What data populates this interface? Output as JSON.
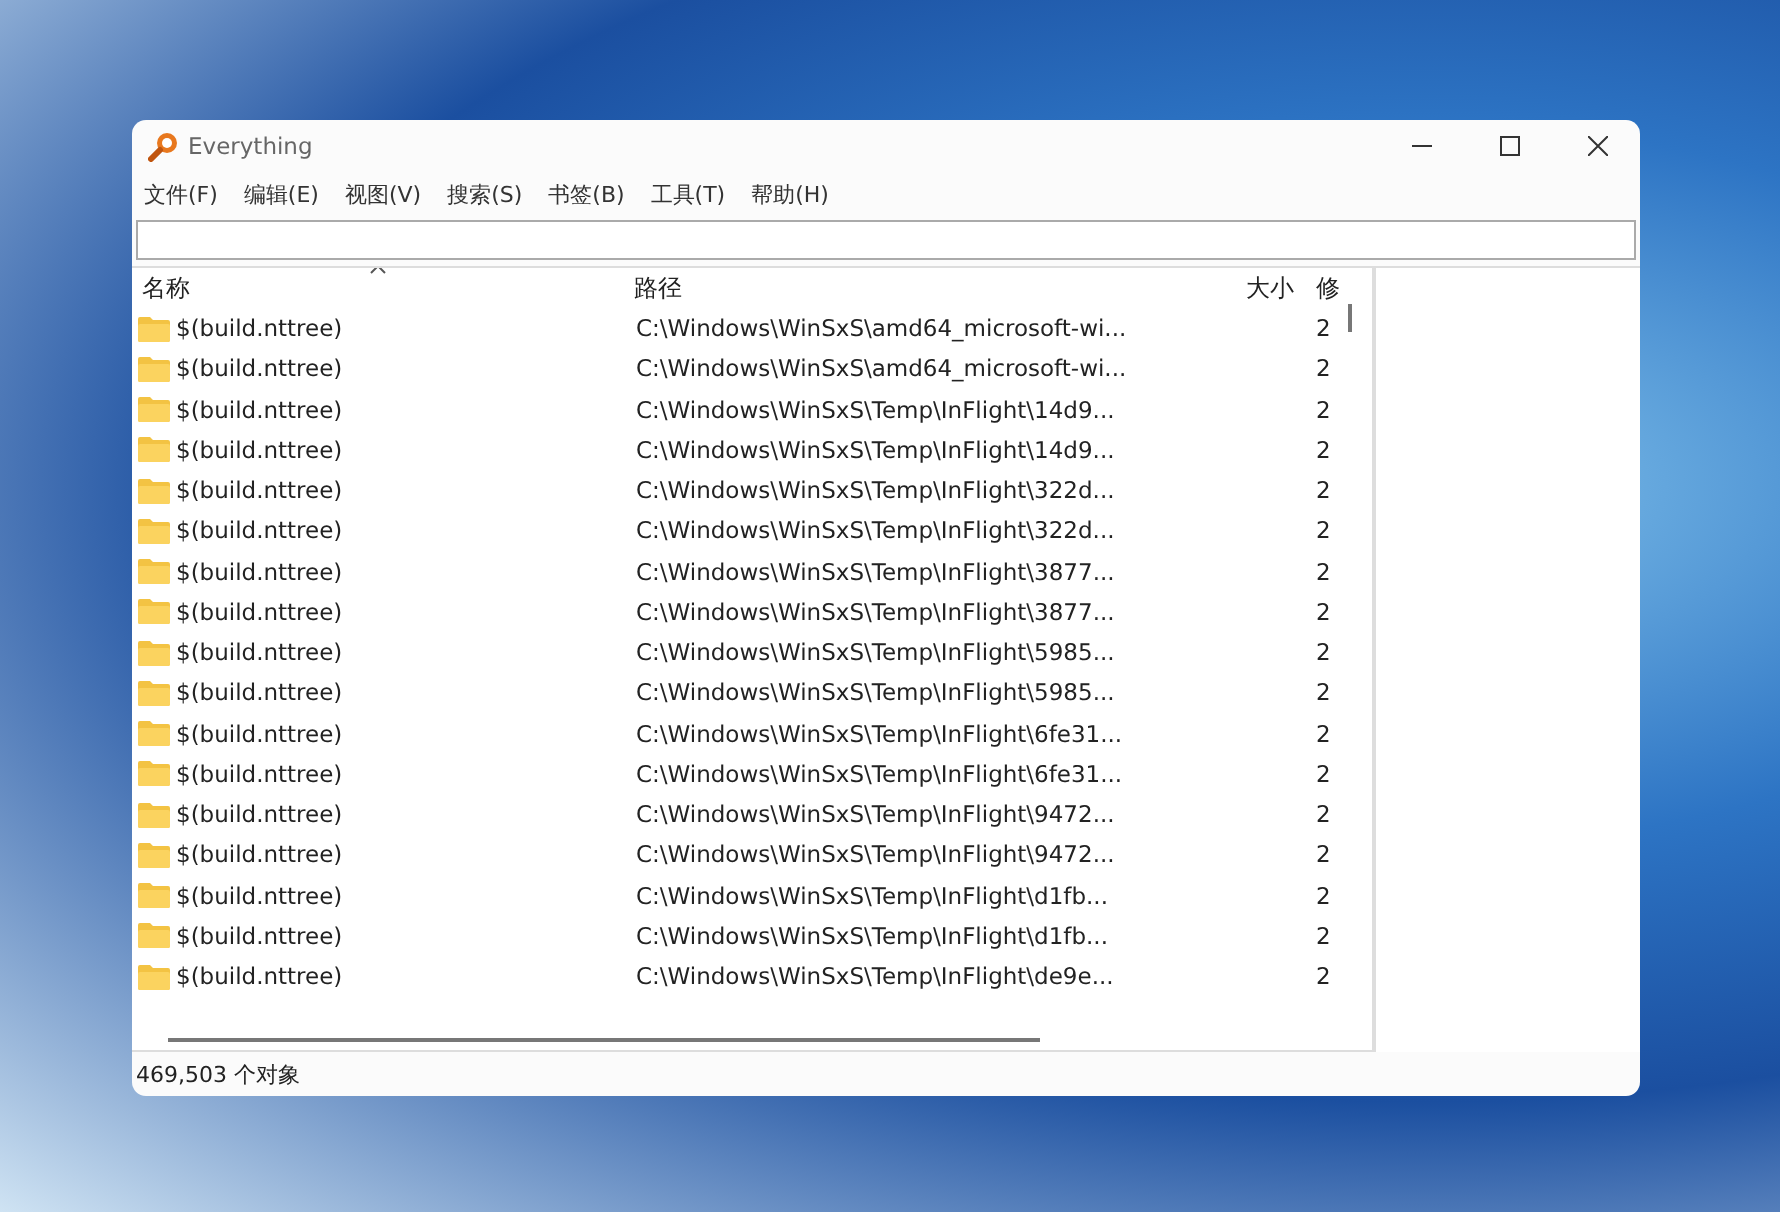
{
  "window": {
    "title": "Everything"
  },
  "menu": [
    "文件(F)",
    "编辑(E)",
    "视图(V)",
    "搜索(S)",
    "书签(B)",
    "工具(T)",
    "帮助(H)"
  ],
  "table": {
    "columns": [
      "名称",
      "路径",
      "大小",
      "修"
    ],
    "rows": [
      {
        "name": "$(build.nttree)",
        "path": "C:\\Windows\\WinSxS\\amd64_microsoft-wi...",
        "column_4": "2"
      },
      {
        "name": "$(build.nttree)",
        "path": "C:\\Windows\\WinSxS\\amd64_microsoft-wi...",
        "column_4": "2"
      },
      {
        "name": "$(build.nttree)",
        "path": "C:\\Windows\\WinSxS\\Temp\\InFlight\\14d9...",
        "column_4": "2"
      },
      {
        "name": "$(build.nttree)",
        "path": "C:\\Windows\\WinSxS\\Temp\\InFlight\\14d9...",
        "column_4": "2"
      },
      {
        "name": "$(build.nttree)",
        "path": "C:\\Windows\\WinSxS\\Temp\\InFlight\\322d...",
        "column_4": "2"
      },
      {
        "name": "$(build.nttree)",
        "path": "C:\\Windows\\WinSxS\\Temp\\InFlight\\322d...",
        "column_4": "2"
      },
      {
        "name": "$(build.nttree)",
        "path": "C:\\Windows\\WinSxS\\Temp\\InFlight\\3877...",
        "column_4": "2"
      },
      {
        "name": "$(build.nttree)",
        "path": "C:\\Windows\\WinSxS\\Temp\\InFlight\\3877...",
        "column_4": "2"
      },
      {
        "name": "$(build.nttree)",
        "path": "C:\\Windows\\WinSxS\\Temp\\InFlight\\5985...",
        "column_4": "2"
      },
      {
        "name": "$(build.nttree)",
        "path": "C:\\Windows\\WinSxS\\Temp\\InFlight\\5985...",
        "column_4": "2"
      },
      {
        "name": "$(build.nttree)",
        "path": "C:\\Windows\\WinSxS\\Temp\\InFlight\\6fe31...",
        "column_4": "2"
      },
      {
        "name": "$(build.nttree)",
        "path": "C:\\Windows\\WinSxS\\Temp\\InFlight\\6fe31...",
        "column_4": "2"
      },
      {
        "name": "$(build.nttree)",
        "path": "C:\\Windows\\WinSxS\\Temp\\InFlight\\9472...",
        "column_4": "2"
      },
      {
        "name": "$(build.nttree)",
        "path": "C:\\Windows\\WinSxS\\Temp\\InFlight\\9472...",
        "column_4": "2"
      },
      {
        "name": "$(build.nttree)",
        "path": "C:\\Windows\\WinSxS\\Temp\\InFlight\\d1fb...",
        "column_4": "2"
      },
      {
        "name": "$(build.nttree)",
        "path": "C:\\Windows\\WinSxS\\Temp\\InFlight\\d1fb...",
        "column_4": "2"
      },
      {
        "name": "$(build.nttree)",
        "path": "C:\\Windows\\WinSxS\\Temp\\InFlight\\de9e...",
        "column_4": "2"
      }
    ]
  },
  "status_bar": "469,503 个对象"
}
